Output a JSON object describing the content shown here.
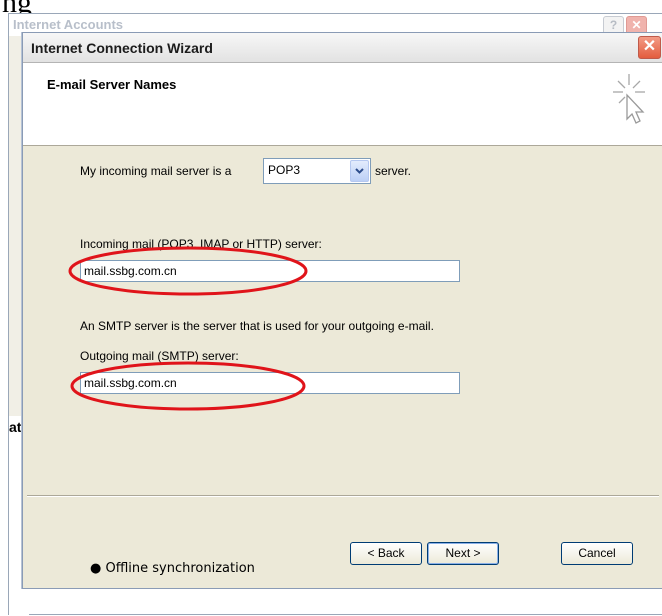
{
  "document_top_text": "ng",
  "background_window": {
    "title": "Internet Accounts",
    "help_button": "?",
    "left_edge_text": "atu"
  },
  "wizard": {
    "title": "Internet Connection Wizard",
    "close_icon": "close-icon",
    "page_title": "E-mail Server Names",
    "header_icon": "wizard-cursor-icon",
    "incoming_prefix": "My incoming mail server is a",
    "incoming_type": "POP3",
    "incoming_suffix": "server.",
    "incoming_label": "Incoming mail (POP3, IMAP or HTTP) server:",
    "incoming_value": "mail.ssbg.com.cn",
    "smtp_note": "An SMTP server is the server that is used for your outgoing e-mail.",
    "outgoing_label": "Outgoing mail (SMTP) server:",
    "outgoing_value": "mail.ssbg.com.cn",
    "buttons": {
      "back": "< Back",
      "next": "Next >",
      "cancel": "Cancel"
    }
  },
  "annotation_color": "#e0141a",
  "page_footer": {
    "bullet": "●",
    "text": "Offline synchronization"
  }
}
